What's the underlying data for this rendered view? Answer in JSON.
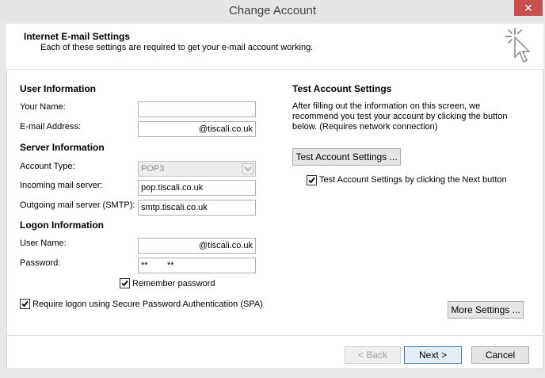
{
  "window": {
    "title": "Change Account",
    "close_glyph": "✕"
  },
  "header": {
    "title": "Internet E-mail Settings",
    "subtitle": "Each of these settings are required to get your e-mail account working."
  },
  "user_info": {
    "section": "User Information",
    "your_name_label": "Your Name:",
    "your_name_value": "",
    "email_label": "E-mail Address:",
    "email_value": "@tiscali.co.uk"
  },
  "server_info": {
    "section": "Server Information",
    "account_type_label": "Account Type:",
    "account_type_value": "POP3",
    "incoming_label": "Incoming mail server:",
    "incoming_value": "pop.tiscali.co.uk",
    "outgoing_label": "Outgoing mail server (SMTP):",
    "outgoing_value": "smtp.tiscali.co.uk"
  },
  "logon_info": {
    "section": "Logon Information",
    "username_label": "User Name:",
    "username_value": "@tiscali.co.uk",
    "password_label": "Password:",
    "password_value": "**        **",
    "remember_label": "Remember password",
    "remember_checked": true,
    "spa_label": "Require logon using Secure Password Authentication (SPA)",
    "spa_checked": false
  },
  "test_settings": {
    "section": "Test Account Settings",
    "description": "After filling out the information on this screen, we recommend you test your account by clicking the button below. (Requires network connection)",
    "test_button": "Test Account Settings ...",
    "next_test_label": "Test Account Settings by clicking the Next button",
    "next_test_checked": true
  },
  "buttons": {
    "more_settings": "More Settings ...",
    "back": "< Back",
    "next": "Next >",
    "cancel": "Cancel"
  },
  "icons": {
    "header": "cursor-sparkle-icon",
    "checkmark": "checkmark-icon",
    "dropdown": "chevron-down-icon"
  }
}
